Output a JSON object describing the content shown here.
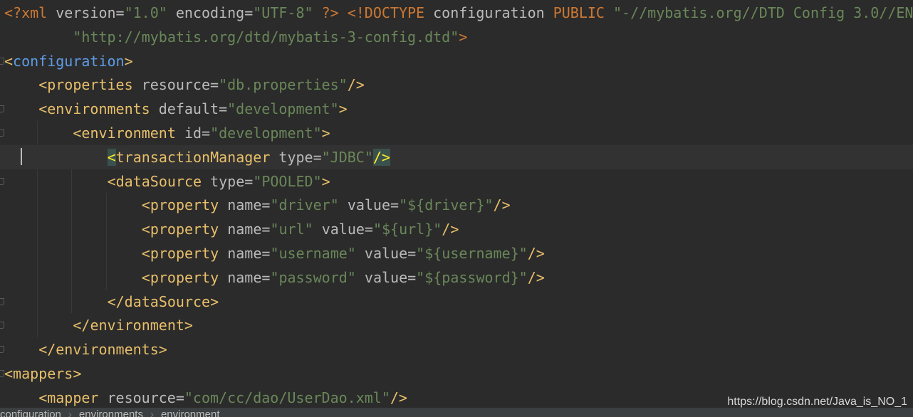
{
  "editor": {
    "language": "xml",
    "current_line_index": 6,
    "lines": [
      {
        "indent": 0,
        "tokens": [
          {
            "text": "<?xml ",
            "kind": "d"
          },
          {
            "text": "version",
            "kind": "a"
          },
          {
            "text": "=",
            "kind": "a"
          },
          {
            "text": "\"1.0\"",
            "kind": "v"
          },
          {
            "text": " ",
            "kind": "a"
          },
          {
            "text": "encoding",
            "kind": "a"
          },
          {
            "text": "=",
            "kind": "a"
          },
          {
            "text": "\"UTF-8\"",
            "kind": "v"
          },
          {
            "text": " ?>",
            "kind": "d"
          },
          {
            "text": " ",
            "kind": "a"
          },
          {
            "text": "<!DOCTYPE ",
            "kind": "d"
          },
          {
            "text": "configuration ",
            "kind": "a"
          },
          {
            "text": "PUBLIC ",
            "kind": "d"
          },
          {
            "text": "\"-//mybatis.org//DTD Config 3.0//EN\"",
            "kind": "v"
          }
        ]
      },
      {
        "indent": 8,
        "tokens": [
          {
            "text": "\"http://mybatis.org/dtd/mybatis-3-config.dtd\"",
            "kind": "v"
          },
          {
            "text": ">",
            "kind": "d"
          }
        ]
      },
      {
        "indent": 0,
        "fold": true,
        "tokens": [
          {
            "text": "<",
            "kind": "t"
          },
          {
            "text": "configuration",
            "kind": "tag-blue"
          },
          {
            "text": ">",
            "kind": "t"
          }
        ]
      },
      {
        "indent": 4,
        "tokens": [
          {
            "text": "<properties ",
            "kind": "t"
          },
          {
            "text": "resource",
            "kind": "a"
          },
          {
            "text": "=",
            "kind": "a"
          },
          {
            "text": "\"db.properties\"",
            "kind": "v"
          },
          {
            "text": "/>",
            "kind": "t"
          }
        ]
      },
      {
        "indent": 4,
        "fold": true,
        "tokens": [
          {
            "text": "<environments ",
            "kind": "t"
          },
          {
            "text": "default",
            "kind": "a"
          },
          {
            "text": "=",
            "kind": "a"
          },
          {
            "text": "\"development\"",
            "kind": "v"
          },
          {
            "text": ">",
            "kind": "t"
          }
        ]
      },
      {
        "indent": 8,
        "fold": true,
        "tokens": [
          {
            "text": "<environment ",
            "kind": "t"
          },
          {
            "text": "id",
            "kind": "a"
          },
          {
            "text": "=",
            "kind": "a"
          },
          {
            "text": "\"development\"",
            "kind": "v"
          },
          {
            "text": ">",
            "kind": "t"
          }
        ]
      },
      {
        "indent": 12,
        "tokens": [
          {
            "text": "<",
            "kind": "t",
            "hl": true
          },
          {
            "text": "transactionManager ",
            "kind": "t"
          },
          {
            "text": "type",
            "kind": "a"
          },
          {
            "text": "=",
            "kind": "a"
          },
          {
            "text": "\"JDBC\"",
            "kind": "v"
          },
          {
            "text": "/>",
            "kind": "t",
            "hl": true
          }
        ]
      },
      {
        "indent": 12,
        "fold": true,
        "tokens": [
          {
            "text": "<dataSource ",
            "kind": "t"
          },
          {
            "text": "type",
            "kind": "a"
          },
          {
            "text": "=",
            "kind": "a"
          },
          {
            "text": "\"POOLED\"",
            "kind": "v"
          },
          {
            "text": ">",
            "kind": "t"
          }
        ]
      },
      {
        "indent": 16,
        "tokens": [
          {
            "text": "<property ",
            "kind": "t"
          },
          {
            "text": "name",
            "kind": "a"
          },
          {
            "text": "=",
            "kind": "a"
          },
          {
            "text": "\"driver\"",
            "kind": "v"
          },
          {
            "text": " ",
            "kind": "a"
          },
          {
            "text": "value",
            "kind": "a"
          },
          {
            "text": "=",
            "kind": "a"
          },
          {
            "text": "\"${driver}\"",
            "kind": "v"
          },
          {
            "text": "/>",
            "kind": "t"
          }
        ]
      },
      {
        "indent": 16,
        "tokens": [
          {
            "text": "<property ",
            "kind": "t"
          },
          {
            "text": "name",
            "kind": "a"
          },
          {
            "text": "=",
            "kind": "a"
          },
          {
            "text": "\"url\"",
            "kind": "v"
          },
          {
            "text": " ",
            "kind": "a"
          },
          {
            "text": "value",
            "kind": "a"
          },
          {
            "text": "=",
            "kind": "a"
          },
          {
            "text": "\"${url}\"",
            "kind": "v"
          },
          {
            "text": "/>",
            "kind": "t"
          }
        ]
      },
      {
        "indent": 16,
        "tokens": [
          {
            "text": "<property ",
            "kind": "t"
          },
          {
            "text": "name",
            "kind": "a"
          },
          {
            "text": "=",
            "kind": "a"
          },
          {
            "text": "\"username\"",
            "kind": "v"
          },
          {
            "text": " ",
            "kind": "a"
          },
          {
            "text": "value",
            "kind": "a"
          },
          {
            "text": "=",
            "kind": "a"
          },
          {
            "text": "\"${username}\"",
            "kind": "v"
          },
          {
            "text": "/>",
            "kind": "t"
          }
        ]
      },
      {
        "indent": 16,
        "tokens": [
          {
            "text": "<property ",
            "kind": "t"
          },
          {
            "text": "name",
            "kind": "a"
          },
          {
            "text": "=",
            "kind": "a"
          },
          {
            "text": "\"password\"",
            "kind": "v"
          },
          {
            "text": " ",
            "kind": "a"
          },
          {
            "text": "value",
            "kind": "a"
          },
          {
            "text": "=",
            "kind": "a"
          },
          {
            "text": "\"${password}\"",
            "kind": "v"
          },
          {
            "text": "/>",
            "kind": "t"
          }
        ]
      },
      {
        "indent": 12,
        "fold": true,
        "tokens": [
          {
            "text": "</dataSource>",
            "kind": "t"
          }
        ]
      },
      {
        "indent": 8,
        "fold": true,
        "tokens": [
          {
            "text": "</environment>",
            "kind": "t"
          }
        ]
      },
      {
        "indent": 4,
        "fold": true,
        "tokens": [
          {
            "text": "</environments>",
            "kind": "t"
          }
        ]
      },
      {
        "indent": 0,
        "fold": true,
        "tokens": [
          {
            "text": "<mappers>",
            "kind": "t"
          }
        ]
      },
      {
        "indent": 4,
        "tokens": [
          {
            "text": "<mapper ",
            "kind": "t"
          },
          {
            "text": "resource",
            "kind": "a"
          },
          {
            "text": "=",
            "kind": "a"
          },
          {
            "text": "\"com/cc/dao/UserDao.xml\"",
            "kind": "v"
          },
          {
            "text": "/>",
            "kind": "t"
          }
        ]
      }
    ]
  },
  "breadcrumb": [
    "configuration",
    "environments",
    "environment"
  ],
  "watermark": "https://blog.csdn.net/Java_is_NO_1",
  "colors": {
    "background": "#2b2b2b",
    "tag": "#e8bf6a",
    "root_tag": "#5e9ce6",
    "attribute": "#bababa",
    "value": "#6a8759",
    "doctype": "#cc7832",
    "brace_highlight": "#ffef28"
  }
}
